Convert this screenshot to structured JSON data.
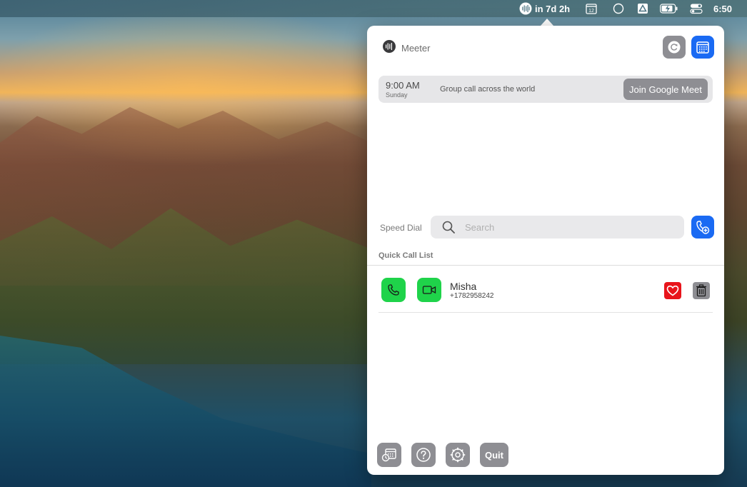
{
  "menubar": {
    "meeter_status": "in 7d 2h",
    "calendar_day": "12",
    "clock": "6:50"
  },
  "app": {
    "title": "Meeter",
    "accent_color": "#1a6af3",
    "action_gray": "#8e8e93",
    "call_green": "#1fd34a",
    "favorite_red": "#e8141b"
  },
  "event": {
    "time": "9:00 AM",
    "day": "Sunday",
    "title": "Group call across the world",
    "join_label": "Join Google Meet"
  },
  "speed_dial": {
    "label": "Speed Dial",
    "search_placeholder": "Search",
    "search_value": ""
  },
  "quick_call": {
    "label": "Quick Call List",
    "contacts": [
      {
        "name": "Misha",
        "phone": "+1782958242",
        "favorite": true
      }
    ]
  },
  "footer": {
    "quit_label": "Quit"
  },
  "icons": [
    "waveform-icon",
    "calendar-icon",
    "circle-icon",
    "drive-icon",
    "battery-charging-icon",
    "control-center-icon",
    "refresh-icon",
    "search-icon",
    "add-contact-icon",
    "phone-icon",
    "video-icon",
    "heart-icon",
    "trash-icon",
    "schedule-icon",
    "help-icon",
    "settings-icon"
  ]
}
